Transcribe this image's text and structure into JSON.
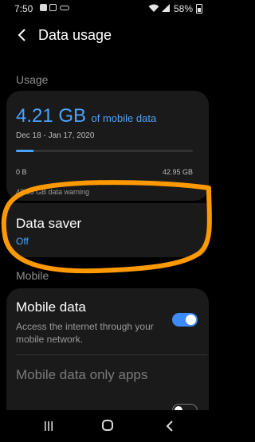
{
  "status_bar": {
    "time": "7:50",
    "battery": "58%",
    "notification_icons": [
      "chat-icon",
      "image-icon",
      "key-icon"
    ]
  },
  "app_bar": {
    "title": "Data usage"
  },
  "usage_section": {
    "header": "Usage",
    "amount": "4.21 GB",
    "amount_suffix": "of mobile data",
    "period": "Dec 18 - Jan 17, 2020",
    "bar_min_label": "0 B",
    "bar_max_label": "42.95 GB",
    "bar_fraction": 0.098,
    "warning_text": "42.95 GB data warning"
  },
  "data_saver": {
    "title": "Data saver",
    "status": "Off"
  },
  "mobile_section": {
    "header": "Mobile",
    "mobile_data": {
      "title": "Mobile data",
      "description": "Access the internet through your mobile network.",
      "enabled": true
    },
    "mobile_data_only_apps": {
      "title": "Mobile data only apps",
      "enabled": false
    }
  },
  "colors": {
    "accent": "#4aa3ff",
    "toggle_on": "#3d8bff",
    "highlight": "#ff9900",
    "background": "#000000",
    "card": "#1a1a1a"
  }
}
